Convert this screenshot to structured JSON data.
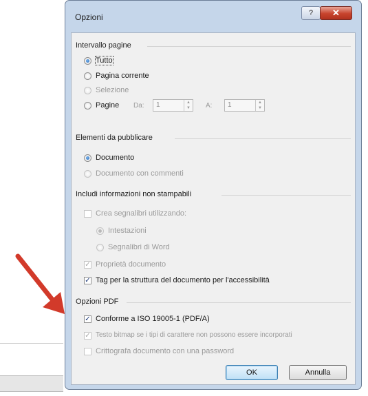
{
  "dialog": {
    "title": "Opzioni",
    "help_label": "?",
    "close_label": "✕"
  },
  "page_range": {
    "group_label": "Intervallo pagine",
    "all_label": "Tutto",
    "current_label": "Pagina corrente",
    "selection_label": "Selezione",
    "pages_label": "Pagine",
    "from_label": "Da:",
    "from_value": "1",
    "to_label": "A:",
    "to_value": "1"
  },
  "publish": {
    "group_label": "Elementi da pubblicare",
    "document_label": "Documento",
    "document_comments_label": "Documento con commenti"
  },
  "nonprint": {
    "group_label": "Includi informazioni non stampabili",
    "bookmarks_label": "Crea segnalibri utilizzando:",
    "headings_label": "Intestazioni",
    "word_bookmarks_label": "Segnalibri di Word",
    "doc_properties_label": "Proprietà documento",
    "tags_label": "Tag per la struttura del documento per l'accessibilità"
  },
  "pdf_options": {
    "group_label": "Opzioni PDF",
    "iso_label": "Conforme a ISO 19005-1 (PDF/A)",
    "bitmap_label": "Testo bitmap se i tipi di carattere non possono essere incorporati",
    "encrypt_label": "Crittografa documento con una password"
  },
  "buttons": {
    "ok_label": "OK",
    "cancel_label": "Annulla"
  },
  "colors": {
    "window_frame": "#c5d6ea",
    "close_button": "#c7432d",
    "annotation_arrow": "#d23a2a"
  }
}
